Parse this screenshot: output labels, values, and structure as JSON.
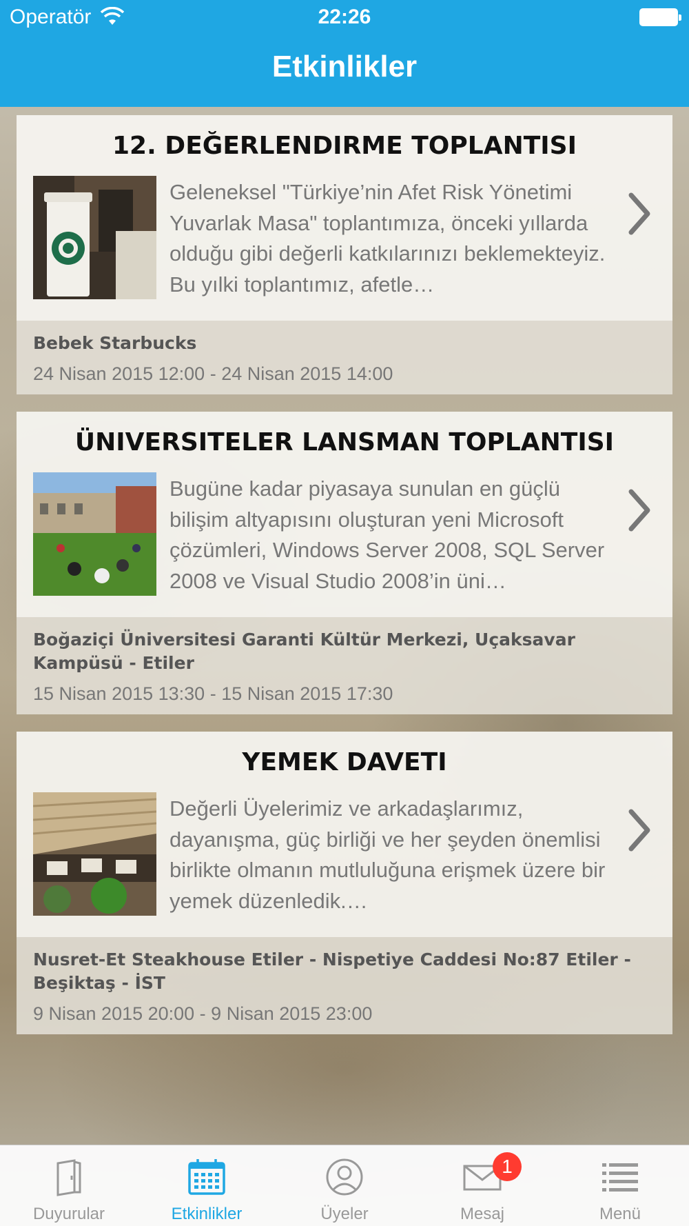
{
  "status_bar": {
    "carrier": "Operatör",
    "time": "22:26"
  },
  "header": {
    "title": "Etkinlikler"
  },
  "events": [
    {
      "title": "12. DEĞERLENDIRME TOPLANTISI",
      "description": "Geleneksel \"Türkiye’nin Afet Risk Yönetimi Yuvarlak Masa\" toplantımıza, önceki yıllarda olduğu gibi değerli katkılarınızı beklemekteyiz. Bu yılki toplantımız, afetle…",
      "venue": "Bebek Starbucks",
      "dates": "24 Nisan 2015 12:00 - 24 Nisan 2015 14:00"
    },
    {
      "title": "ÜNIVERSITELER LANSMAN TOPLANTISI",
      "description": "Bugüne kadar piyasaya sunulan en güçlü bilişim altyapısını oluşturan yeni Microsoft çözümleri, Windows Server 2008, SQL Server 2008 ve Visual Studio 2008’in üni…",
      "venue": "Boğaziçi Üniversitesi Garanti Kültür Merkezi, Uçaksavar Kampüsü - Etiler",
      "dates": "15 Nisan 2015 13:30 - 15 Nisan 2015 17:30"
    },
    {
      "title": "YEMEK DAVETI",
      "description": "Değerli Üyelerimiz ve arkadaşlarımız, dayanışma, güç birliği ve her şeyden önemlisi birlikte olmanın mutluluğuna erişmek üzere bir yemek düzenledik.…",
      "venue": "Nusret-Et Steakhouse Etiler - Nispetiye Caddesi No:87 Etiler - Beşiktaş - İST",
      "dates": "9 Nisan 2015 20:00 - 9 Nisan 2015 23:00"
    }
  ],
  "tabbar": {
    "tabs": [
      {
        "label": "Duyurular",
        "icon": "book-icon"
      },
      {
        "label": "Etkinlikler",
        "icon": "calendar-icon",
        "active": true
      },
      {
        "label": "Üyeler",
        "icon": "user-icon"
      },
      {
        "label": "Mesaj",
        "icon": "envelope-icon",
        "badge": "1"
      },
      {
        "label": "Menü",
        "icon": "list-icon"
      }
    ]
  },
  "colors": {
    "accent": "#1fa7e3",
    "badge": "#ff3b30"
  }
}
